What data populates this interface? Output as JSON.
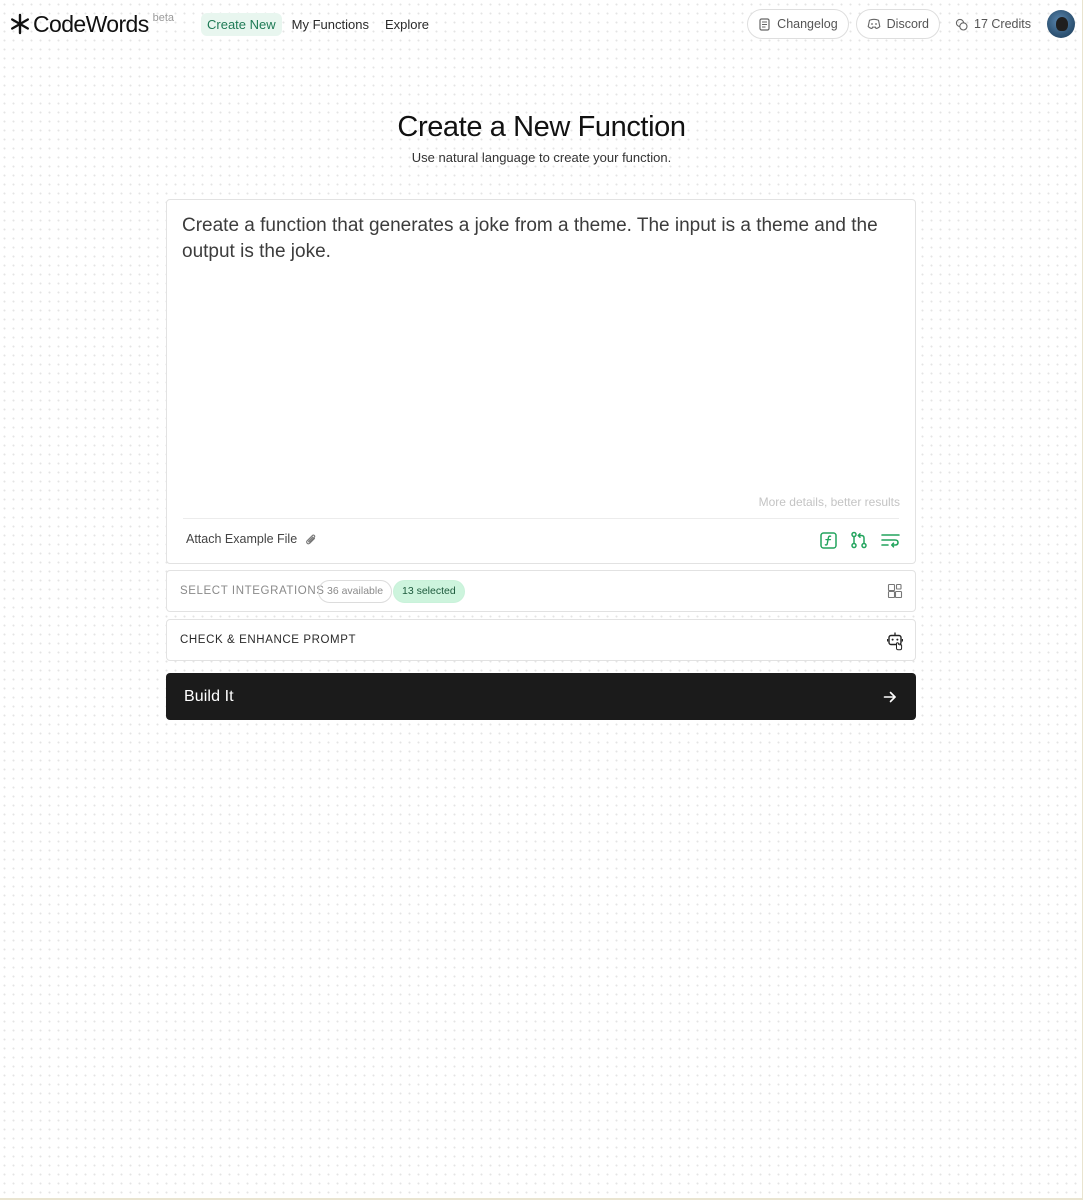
{
  "header": {
    "logo_text": "CodeWords",
    "beta_label": "beta",
    "nav": [
      {
        "label": "Create New",
        "active": true
      },
      {
        "label": "My Functions",
        "active": false
      },
      {
        "label": "Explore",
        "active": false
      }
    ],
    "changelog_label": "Changelog",
    "discord_label": "Discord",
    "credits_label": "17 Credits"
  },
  "main": {
    "title": "Create a New Function",
    "subtitle": "Use natural language to create your function.",
    "prompt": {
      "value": "Create a function that generates a joke from a theme. The input is a theme and the output is the joke.",
      "hint": "More details, better results",
      "attach_label": "Attach Example File"
    },
    "integrations": {
      "label": "SELECT INTEGRATIONS",
      "available": "36 available",
      "selected": "13 selected"
    },
    "enhance": {
      "label": "CHECK & ENHANCE PROMPT"
    },
    "build_label": "Build It"
  },
  "icons": {
    "logo": "asterisk-logo-icon",
    "changelog": "document-icon",
    "discord": "discord-icon",
    "credits": "coins-icon",
    "attach": "paperclip-icon",
    "tools": [
      "function-icon",
      "git-branch-icon",
      "filter-icon"
    ],
    "integrations": "grid-add-icon",
    "enhance": "robot-icon",
    "build": "arrow-right-icon"
  },
  "colors": {
    "accent_green": "#22a45d",
    "active_nav_bg": "#e8f6ef",
    "build_bg": "#1b1b1b",
    "selected_badge_bg": "#cdf4dd"
  }
}
